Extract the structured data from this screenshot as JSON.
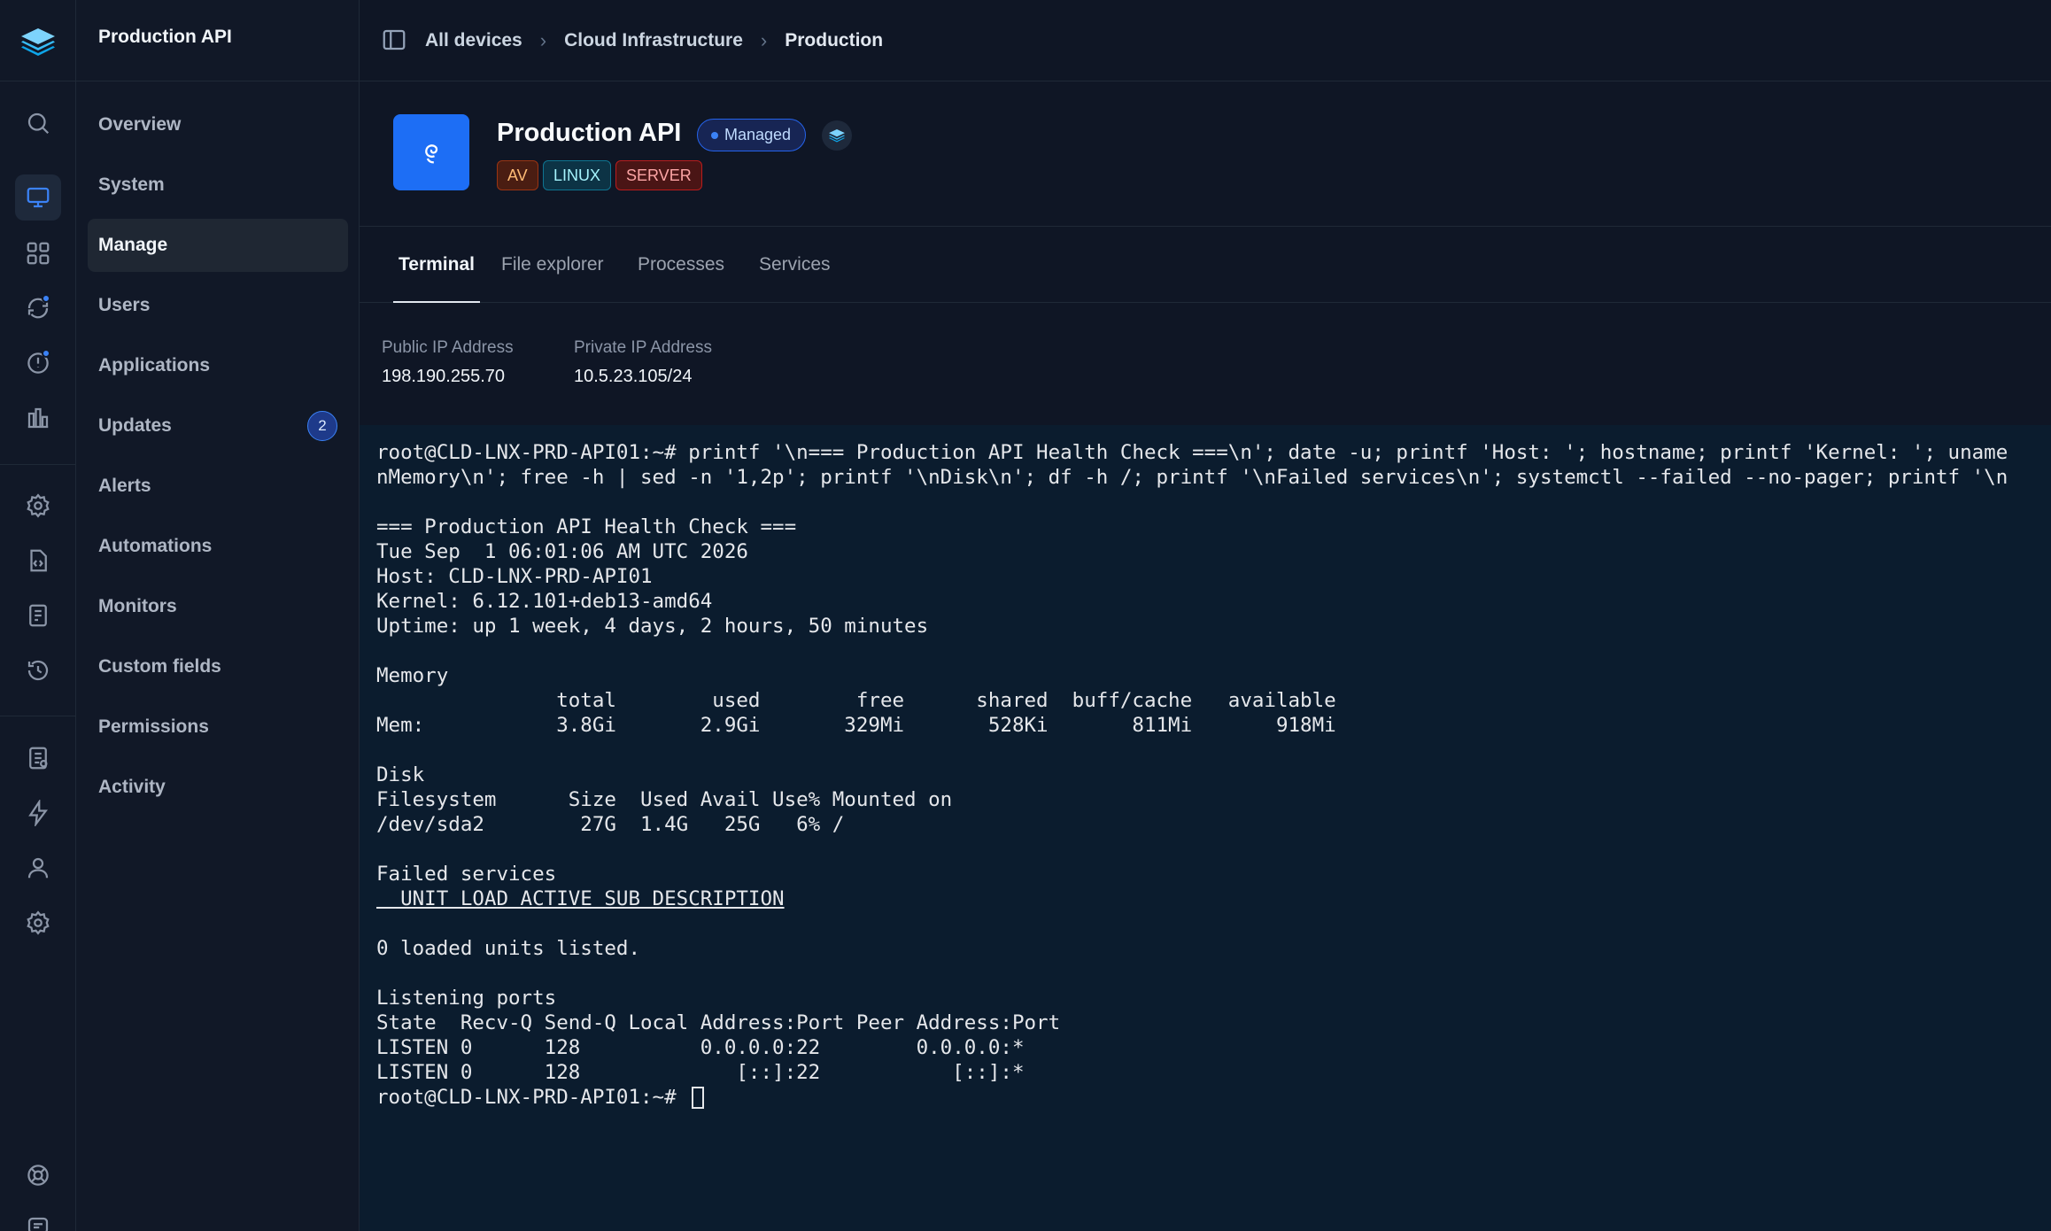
{
  "app": {
    "title": "Production API"
  },
  "nav": {
    "items": [
      {
        "label": "Overview"
      },
      {
        "label": "System"
      },
      {
        "label": "Manage",
        "active": true
      },
      {
        "label": "Users"
      },
      {
        "label": "Applications"
      },
      {
        "label": "Updates",
        "count": "2"
      },
      {
        "label": "Alerts"
      },
      {
        "label": "Automations"
      },
      {
        "label": "Monitors"
      },
      {
        "label": "Custom fields"
      },
      {
        "label": "Permissions"
      },
      {
        "label": "Activity"
      }
    ]
  },
  "breadcrumb": {
    "items": [
      "All devices",
      "Cloud Infrastructure",
      "Production"
    ],
    "separator": "›"
  },
  "device": {
    "name": "Production API",
    "status": "Managed",
    "tags": [
      "AV",
      "LINUX",
      "SERVER"
    ]
  },
  "tabs": [
    "Terminal",
    "File explorer",
    "Processes",
    "Services"
  ],
  "network": {
    "public_label": "Public IP Address",
    "public_value": "198.190.255.70",
    "private_label": "Private IP Address",
    "private_value": "10.5.23.105/24"
  },
  "terminal": {
    "lines": [
      "root@CLD-LNX-PRD-API01:~# printf '\\n=== Production API Health Check ===\\n'; date -u; printf 'Host: '; hostname; printf 'Kernel: '; uname",
      "nMemory\\n'; free -h | sed -n '1,2p'; printf '\\nDisk\\n'; df -h /; printf '\\nFailed services\\n'; systemctl --failed --no-pager; printf '\\n",
      "",
      "=== Production API Health Check ===",
      "Tue Sep  1 06:01:06 AM UTC 2026",
      "Host: CLD-LNX-PRD-API01",
      "Kernel: 6.12.101+deb13-amd64",
      "Uptime: up 1 week, 4 days, 2 hours, 50 minutes",
      "",
      "Memory",
      "               total        used        free      shared  buff/cache   available",
      "Mem:           3.8Gi       2.9Gi       329Mi       528Ki       811Mi       918Mi",
      "",
      "Disk",
      "Filesystem      Size  Used Avail Use% Mounted on",
      "/dev/sda2        27G  1.4G   25G   6% /",
      "",
      "Failed services",
      "  UNIT LOAD ACTIVE SUB DESCRIPTION",
      "",
      "0 loaded units listed.",
      "",
      "Listening ports",
      "State  Recv-Q Send-Q Local Address:Port Peer Address:Port",
      "LISTEN 0      128          0.0.0.0:22        0.0.0.0:*",
      "LISTEN 0      128             [::]:22           [::]:*",
      "root@CLD-LNX-PRD-API01:~# "
    ]
  },
  "colors": {
    "accent": "#3b82f6",
    "background": "#0f172a",
    "terminal_bg": "#0b1c2e"
  }
}
